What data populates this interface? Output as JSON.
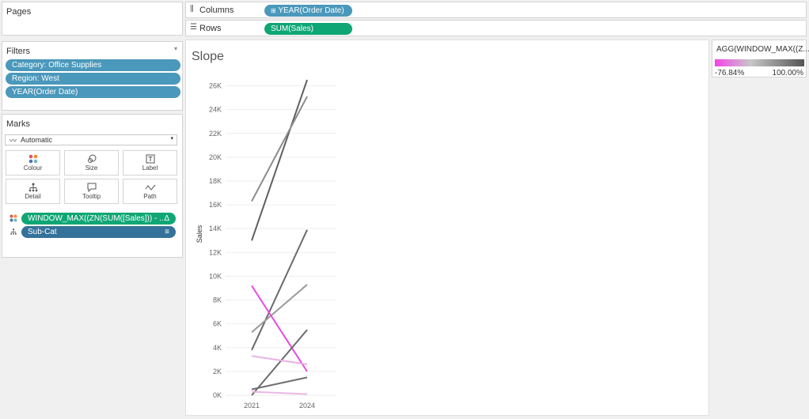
{
  "pages": {
    "title": "Pages"
  },
  "columns": {
    "label": "Columns",
    "pill": "YEAR(Order Date)",
    "pill_icon": "plus-box-icon"
  },
  "rows": {
    "label": "Rows",
    "pill": "SUM(Sales)"
  },
  "filters": {
    "title": "Filters",
    "items": [
      "Category: Office Supplies",
      "Region: West",
      "YEAR(Order Date)"
    ]
  },
  "marks": {
    "title": "Marks",
    "type": "Automatic",
    "buttons": [
      "Colour",
      "Size",
      "Label",
      "Detail",
      "Tooltip",
      "Path"
    ],
    "cards": [
      {
        "label": "WINDOW_MAX((ZN(SUM([Sales])) - ..",
        "suffix": "Δ",
        "icon": "colour-dots-icon"
      },
      {
        "label": "Sub-Cat",
        "suffix": "≡",
        "icon": "detail-icon"
      }
    ]
  },
  "legend": {
    "title": "AGG(WINDOW_MAX((Z...",
    "min_label": "-76.84%",
    "max_label": "100.00%",
    "colors": {
      "low": "#f542e8",
      "mid": "#c7c7c7",
      "high": "#555555"
    }
  },
  "chart_data": {
    "type": "line",
    "title": "Slope",
    "ylabel": "Sales",
    "xlabel": "",
    "categories": [
      "2021",
      "2024"
    ],
    "ylim": [
      0,
      26500
    ],
    "yticks": [
      0,
      2000,
      4000,
      6000,
      8000,
      10000,
      12000,
      14000,
      16000,
      18000,
      20000,
      22000,
      24000,
      26000
    ],
    "ytick_labels": [
      "0K",
      "2K",
      "4K",
      "6K",
      "8K",
      "10K",
      "12K",
      "14K",
      "16K",
      "18K",
      "20K",
      "22K",
      "24K",
      "26K"
    ],
    "grid": true,
    "series": [
      {
        "values": [
          13000,
          26500
        ],
        "color": "#5f5f61"
      },
      {
        "values": [
          16300,
          25100
        ],
        "color": "#8c8c8e"
      },
      {
        "values": [
          3800,
          13900
        ],
        "color": "#6a6a6c"
      },
      {
        "values": [
          5300,
          9300
        ],
        "color": "#9a9a9c"
      },
      {
        "values": [
          9200,
          2000
        ],
        "color": "#e84be0"
      },
      {
        "values": [
          0,
          5500
        ],
        "color": "#6c6c6e"
      },
      {
        "values": [
          3300,
          2600
        ],
        "color": "#e7b0e2"
      },
      {
        "values": [
          500,
          1500
        ],
        "color": "#707072"
      },
      {
        "values": [
          300,
          100
        ],
        "color": "#e9b8e5"
      }
    ]
  }
}
